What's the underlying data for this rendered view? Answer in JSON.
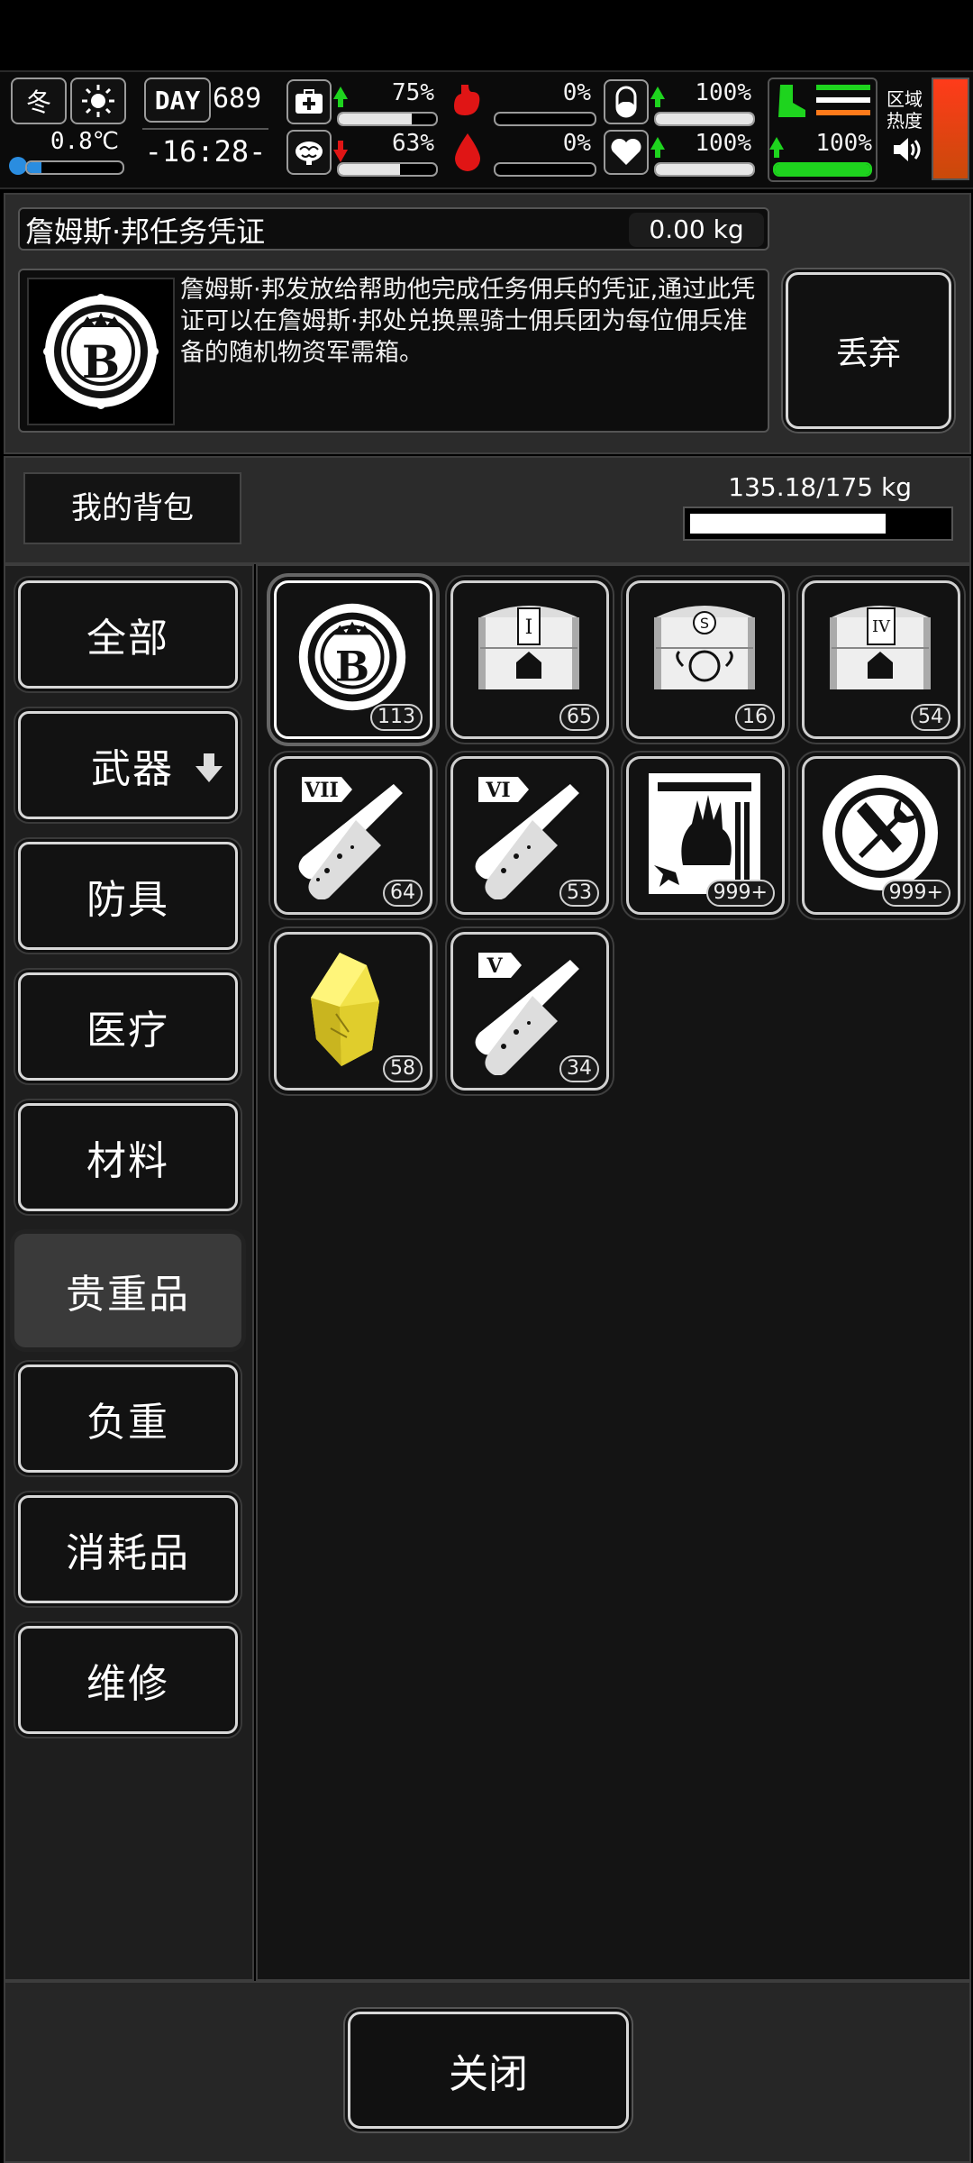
{
  "status": {
    "season": "冬",
    "temperature": "0.8℃",
    "day_label": "DAY",
    "day": "689",
    "time": "-16:28-",
    "health_pct": "75%",
    "stomach_pct": "0%",
    "stamina_pct": "100%",
    "mood_pct": "63%",
    "blood_pct": "0%",
    "heart_pct": "100%",
    "leg_pct": "100%",
    "area_heat_label_1": "区域",
    "area_heat_label_2": "热度",
    "bars": {
      "health": 0.75,
      "mood": 0.63,
      "stomach": 0.0,
      "blood": 0.0,
      "stamina": 1.0,
      "heart": 1.0,
      "leg": 1.0,
      "temperature": 0.15
    },
    "colors": {
      "up": "#1ed41e",
      "down": "#e01515",
      "heat": "#e25a0f"
    }
  },
  "item_detail": {
    "name": "詹姆斯·邦任务凭证",
    "weight": "0.00 kg",
    "description": "詹姆斯·邦发放给帮助他完成任务佣兵的凭证,通过此凭证可以在詹姆斯·邦处兑换黑骑士佣兵团为每位佣兵准备的随机物资军需箱。",
    "icon": "b-coin-icon",
    "discard_label": "丢弃"
  },
  "backpack": {
    "title": "我的背包",
    "weight_text": "135.18/175 kg",
    "weight_fraction": 0.7725
  },
  "categories": [
    {
      "label": "全部",
      "active": false
    },
    {
      "label": "武器",
      "active": false,
      "has_alert": true
    },
    {
      "label": "防具",
      "active": false
    },
    {
      "label": "医疗",
      "active": false
    },
    {
      "label": "材料",
      "active": false
    },
    {
      "label": "贵重品",
      "active": true
    },
    {
      "label": "负重",
      "active": false
    },
    {
      "label": "消耗品",
      "active": false
    },
    {
      "label": "维修",
      "active": false
    }
  ],
  "items": [
    {
      "icon": "b-coin-icon",
      "count": "113",
      "selected": true
    },
    {
      "icon": "supply-chest-i-icon",
      "count": "65",
      "tier": "I"
    },
    {
      "icon": "supply-chest-emblem-icon",
      "count": "16"
    },
    {
      "icon": "supply-chest-iv-icon",
      "count": "54",
      "tier": "IV"
    },
    {
      "icon": "test-tube-vii-icon",
      "count": "64",
      "tier": "VII"
    },
    {
      "icon": "test-tube-vi-icon",
      "count": "53",
      "tier": "VI"
    },
    {
      "icon": "zombie-hand-card-icon",
      "count": "999+"
    },
    {
      "icon": "wrench-token-icon",
      "count": "999+"
    },
    {
      "icon": "gold-crystal-icon",
      "count": "58"
    },
    {
      "icon": "test-tube-v-icon",
      "count": "34",
      "tier": "V"
    }
  ],
  "footer": {
    "close_label": "关闭"
  }
}
